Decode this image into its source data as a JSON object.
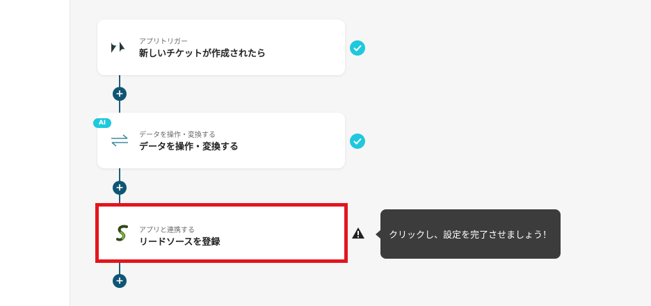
{
  "flow": {
    "steps": [
      {
        "subtitle": "アプリトリガー",
        "title": "新しいチケットが作成されたら",
        "app_icon": "zendesk-icon",
        "status": "complete"
      },
      {
        "badge": "AI",
        "subtitle": "データを操作・変換する",
        "title": "データを操作・変換する",
        "app_icon": "transform-arrows-icon",
        "status": "complete"
      },
      {
        "subtitle": "アプリと連携する",
        "title": "リードソースを登録",
        "app_icon": "leadsource-icon",
        "status": "warning"
      }
    ],
    "add_step_label": "+",
    "tooltip": "クリックし、設定を完了させましょう！"
  },
  "colors": {
    "accent": "#1fc8dd",
    "connector": "#0f5675",
    "highlight": "#e3151d",
    "tooltip_bg": "#3c3c3c"
  }
}
